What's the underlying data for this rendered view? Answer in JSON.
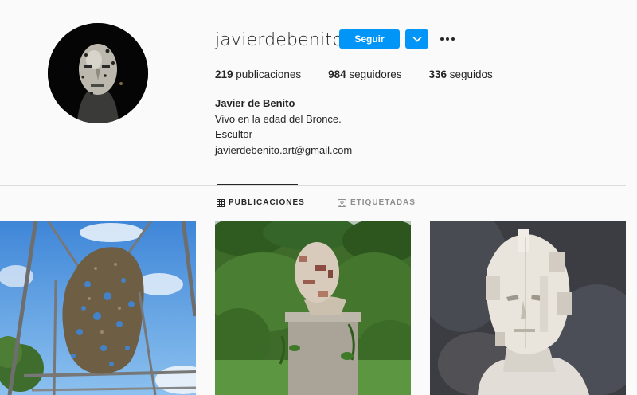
{
  "profile": {
    "username": "javierdebenito",
    "follow_label": "Seguir",
    "stats": [
      {
        "count": "219",
        "label": "publicaciones"
      },
      {
        "count": "984",
        "label": "seguidores"
      },
      {
        "count": "336",
        "label": "seguidos"
      }
    ],
    "full_name": "Javier de Benito",
    "bio_lines": [
      "Vivo en la edad del Bronce.",
      "Escultor",
      "javierdebenito.art@gmail.com"
    ]
  },
  "tabs": [
    {
      "label": "PUBLICACIONES",
      "icon": "grid-icon",
      "active": true
    },
    {
      "label": "ETIQUETADAS",
      "icon": "tagged-icon",
      "active": false
    }
  ],
  "colors": {
    "accent": "#0095f6",
    "text": "#262626",
    "muted": "#8e8e8e",
    "background": "#fafafa"
  },
  "posts": [
    {
      "subject": "wire-head-sculpture"
    },
    {
      "subject": "garden-bust-sculpture"
    },
    {
      "subject": "white-fragmented-bust"
    }
  ]
}
